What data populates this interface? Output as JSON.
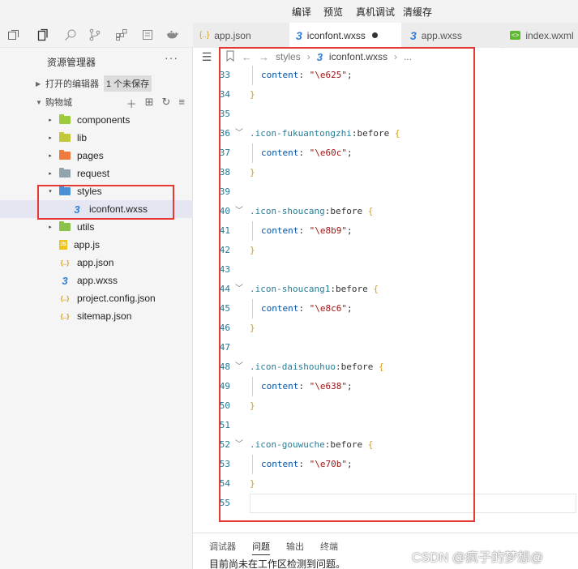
{
  "top_menu": {
    "items": [
      "编译",
      "预览",
      "真机调试",
      "清缓存"
    ]
  },
  "activity_bar": {
    "icons": [
      "window-icon",
      "files-icon",
      "search-icon",
      "source-control-icon",
      "extensions-icon",
      "debug-icon",
      "docker-icon"
    ]
  },
  "tabs": [
    {
      "label": "app.json",
      "icon": "{..}",
      "icon_color": "#d4a017",
      "active": false
    },
    {
      "label": "iconfont.wxss",
      "icon": "3",
      "icon_color": "#2f7fd8",
      "active": true,
      "unsaved": true
    },
    {
      "label": "app.wxss",
      "icon": "3",
      "icon_color": "#2f7fd8",
      "active": false
    },
    {
      "label": "index.wxml",
      "icon": "<>",
      "icon_color": "#5fb832",
      "active": false
    }
  ],
  "sidebar": {
    "title": "资源管理器",
    "more": "···",
    "open_editors": {
      "label": "打开的编辑器",
      "badge": "1 个未保存"
    },
    "project": {
      "label": "购物城"
    },
    "tree": [
      {
        "label": "components",
        "kind": "folder",
        "color": "#9ccc3c",
        "twisty": "▸"
      },
      {
        "label": "lib",
        "kind": "folder",
        "color": "#c3c83a",
        "twisty": "▸"
      },
      {
        "label": "pages",
        "kind": "folder",
        "color": "#f07b3f",
        "twisty": "▸"
      },
      {
        "label": "request",
        "kind": "folder",
        "color": "#90a4ae",
        "twisty": "▸"
      },
      {
        "label": "styles",
        "kind": "folder-open",
        "color": "#4a90d9",
        "twisty": "▾"
      },
      {
        "label": "iconfont.wxss",
        "kind": "wxss",
        "color": "#2f7fd8",
        "twisty": "",
        "selected": true
      },
      {
        "label": "utils",
        "kind": "folder",
        "color": "#8bc34a",
        "twisty": "▸"
      },
      {
        "label": "app.js",
        "kind": "js",
        "color": "#f0c419",
        "twisty": ""
      },
      {
        "label": "app.json",
        "kind": "json",
        "color": "#d4a017",
        "twisty": ""
      },
      {
        "label": "app.wxss",
        "kind": "wxss",
        "color": "#2f7fd8",
        "twisty": ""
      },
      {
        "label": "project.config.json",
        "kind": "json",
        "color": "#d4a017",
        "twisty": ""
      },
      {
        "label": "sitemap.json",
        "kind": "json",
        "color": "#d4a017",
        "twisty": ""
      }
    ]
  },
  "breadcrumb": {
    "folder": "styles",
    "file": "iconfont.wxss",
    "tail": "..."
  },
  "code_lines": [
    {
      "n": "33",
      "kind": "decl",
      "prop": "content",
      "value": "\"\\e625\""
    },
    {
      "n": "34",
      "kind": "close"
    },
    {
      "n": "35",
      "kind": "blank"
    },
    {
      "n": "36",
      "kind": "rule",
      "selector": ".icon-fukuantongzhi",
      "pseudo": ":before"
    },
    {
      "n": "37",
      "kind": "decl",
      "prop": "content",
      "value": "\"\\e60c\""
    },
    {
      "n": "38",
      "kind": "close"
    },
    {
      "n": "39",
      "kind": "blank"
    },
    {
      "n": "40",
      "kind": "rule",
      "selector": ".icon-shoucang",
      "pseudo": ":before"
    },
    {
      "n": "41",
      "kind": "decl",
      "prop": "content",
      "value": "\"\\e8b9\""
    },
    {
      "n": "42",
      "kind": "close"
    },
    {
      "n": "43",
      "kind": "blank"
    },
    {
      "n": "44",
      "kind": "rule",
      "selector": ".icon-shoucang1",
      "pseudo": ":before"
    },
    {
      "n": "45",
      "kind": "decl",
      "prop": "content",
      "value": "\"\\e8c6\""
    },
    {
      "n": "46",
      "kind": "close"
    },
    {
      "n": "47",
      "kind": "blank"
    },
    {
      "n": "48",
      "kind": "rule",
      "selector": ".icon-daishouhuo",
      "pseudo": ":before"
    },
    {
      "n": "49",
      "kind": "decl",
      "prop": "content",
      "value": "\"\\e638\""
    },
    {
      "n": "50",
      "kind": "close"
    },
    {
      "n": "51",
      "kind": "blank"
    },
    {
      "n": "52",
      "kind": "rule",
      "selector": ".icon-gouwuche",
      "pseudo": ":before"
    },
    {
      "n": "53",
      "kind": "decl",
      "prop": "content",
      "value": "\"\\e70b\""
    },
    {
      "n": "54",
      "kind": "close"
    },
    {
      "n": "55",
      "kind": "current"
    }
  ],
  "panel": {
    "tabs": [
      "调试器",
      "问题",
      "输出",
      "终端"
    ],
    "active_tab": "问题",
    "message": "目前尚未在工作区检测到问题。"
  },
  "watermark": "CSDN @疯子的梦想@",
  "colors": {
    "annotation_box": "#e53935",
    "line_numbers": "#237893",
    "string": "#a31515",
    "selector": "#267f99"
  }
}
